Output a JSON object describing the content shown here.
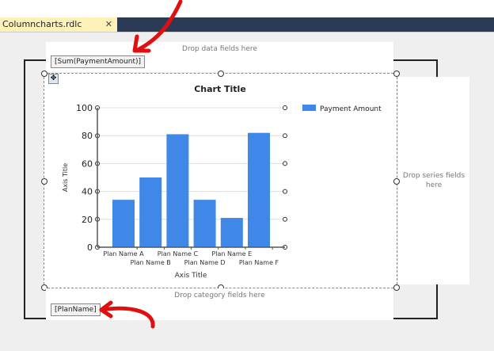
{
  "tab": {
    "title": "Columncharts.rdlc [Design]*",
    "close": "✕"
  },
  "drop": {
    "data": "Drop data fields here",
    "category": "Drop category fields here",
    "series": "Drop series fields here"
  },
  "fields": {
    "value": "[Sum(PaymentAmount)]",
    "category": "[PlanName]"
  },
  "colors": {
    "bar": "#3f88e8",
    "annotation": "#e01010"
  },
  "chart_data": {
    "type": "bar",
    "title": "Chart Title",
    "xlabel": "Axis Title",
    "ylabel": "Axis Title",
    "categories": [
      "Plan Name A",
      "Plan Name B",
      "Plan Name C",
      "Plan Name D",
      "Plan Name E",
      "Plan Name F"
    ],
    "series": [
      {
        "name": "Payment Amount",
        "values": [
          34,
          50,
          81,
          34,
          21,
          82
        ]
      }
    ],
    "ylim": [
      0,
      100
    ],
    "yticks": [
      "0",
      "20",
      "40",
      "60",
      "80",
      "100"
    ],
    "legend": "top-right",
    "grid": true
  }
}
